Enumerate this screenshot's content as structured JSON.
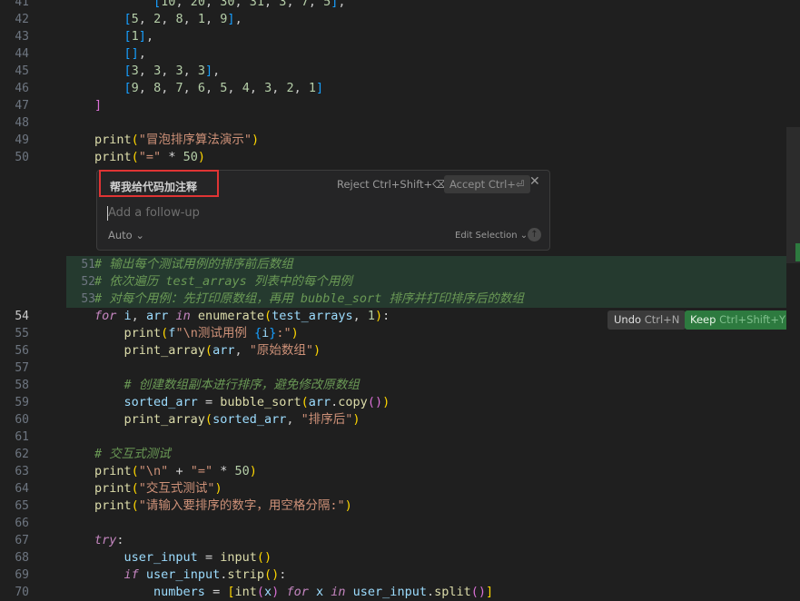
{
  "editor": {
    "lines": [
      {
        "n": "41",
        "html": "        <span class='p3'>[</span><span class='num'>10</span>, <span class='num'>20</span>, <span class='num'>30</span>, <span class='num'>31</span>, <span class='num'>3</span>, <span class='num'>7</span>, <span class='num'>5</span><span class='p3'>]</span>,"
      },
      {
        "n": "42",
        "html": "    <span class='p3'>[</span><span class='num'>5</span>, <span class='num'>2</span>, <span class='num'>8</span>, <span class='num'>1</span>, <span class='num'>9</span><span class='p3'>]</span>,"
      },
      {
        "n": "43",
        "html": "    <span class='p3'>[</span><span class='num'>1</span><span class='p3'>]</span>,"
      },
      {
        "n": "44",
        "html": "    <span class='p3'>[]</span>,"
      },
      {
        "n": "45",
        "html": "    <span class='p3'>[</span><span class='num'>3</span>, <span class='num'>3</span>, <span class='num'>3</span>, <span class='num'>3</span><span class='p3'>]</span>,"
      },
      {
        "n": "46",
        "html": "    <span class='p3'>[</span><span class='num'>9</span>, <span class='num'>8</span>, <span class='num'>7</span>, <span class='num'>6</span>, <span class='num'>5</span>, <span class='num'>4</span>, <span class='num'>3</span>, <span class='num'>2</span>, <span class='num'>1</span><span class='p3'>]</span>"
      },
      {
        "n": "47",
        "html": "<span class='p2'>]</span>"
      },
      {
        "n": "48",
        "html": ""
      },
      {
        "n": "49",
        "html": "<span class='fn'>print</span><span class='p1'>(</span><span class='str'>\"冒泡排序算法演示\"</span><span class='p1'>)</span>"
      },
      {
        "n": "50",
        "html": "<span class='fn'>print</span><span class='p1'>(</span><span class='str'>\"=\"</span> <span class='op'>*</span> <span class='num'>50</span><span class='p1'>)</span>"
      },
      {
        "n": "51",
        "html": "<span class='cmt'># 输出每个测试用例的排序前后数组</span>",
        "hl": true
      },
      {
        "n": "52",
        "html": "<span class='cmt'># 依次遍历 test_arrays 列表中的每个用例</span>",
        "hl": true
      },
      {
        "n": "53",
        "html": "<span class='cmt'># 对每个用例：先打印原数组，再用 bubble_sort 排序并打印排序后的数组</span>",
        "hl": true
      },
      {
        "n": "54",
        "html": "<span class='kw'>for</span> <span class='var'>i</span>, <span class='var'>arr</span> <span class='kw'>in</span> <span class='fn'>enumerate</span><span class='p1'>(</span><span class='var'>test_arrays</span>, <span class='num'>1</span><span class='p1'>)</span>:",
        "active": true
      },
      {
        "n": "55",
        "html": "    <span class='fn'>print</span><span class='p1'>(</span><span class='var'>f</span><span class='str'>\"\\n测试用例 </span><span class='p3'>{</span><span class='var'>i</span><span class='p3'>}</span><span class='str'>:\"</span><span class='p1'>)</span>"
      },
      {
        "n": "56",
        "html": "    <span class='fn'>print_array</span><span class='p1'>(</span><span class='var'>arr</span>, <span class='str'>\"原始数组\"</span><span class='p1'>)</span>"
      },
      {
        "n": "57",
        "html": ""
      },
      {
        "n": "58",
        "html": "    <span class='cmt'># 创建数组副本进行排序，避免修改原数组</span>"
      },
      {
        "n": "59",
        "html": "    <span class='var'>sorted_arr</span> <span class='op'>=</span> <span class='fn'>bubble_sort</span><span class='p1'>(</span><span class='var'>arr</span>.<span class='fn'>copy</span><span class='p2'>()</span><span class='p1'>)</span>"
      },
      {
        "n": "60",
        "html": "    <span class='fn'>print_array</span><span class='p1'>(</span><span class='var'>sorted_arr</span>, <span class='str'>\"排序后\"</span><span class='p1'>)</span>"
      },
      {
        "n": "61",
        "html": ""
      },
      {
        "n": "62",
        "html": "<span class='cmt'># 交互式测试</span>"
      },
      {
        "n": "63",
        "html": "<span class='fn'>print</span><span class='p1'>(</span><span class='str'>\"\\n\"</span> <span class='op'>+</span> <span class='str'>\"=\"</span> <span class='op'>*</span> <span class='num'>50</span><span class='p1'>)</span>"
      },
      {
        "n": "64",
        "html": "<span class='fn'>print</span><span class='p1'>(</span><span class='str'>\"交互式测试\"</span><span class='p1'>)</span>"
      },
      {
        "n": "65",
        "html": "<span class='fn'>print</span><span class='p1'>(</span><span class='str'>\"请输入要排序的数字，用空格分隔:\"</span><span class='p1'>)</span>"
      },
      {
        "n": "66",
        "html": ""
      },
      {
        "n": "67",
        "html": "<span class='kw'>try</span>:"
      },
      {
        "n": "68",
        "html": "    <span class='var'>user_input</span> <span class='op'>=</span> <span class='fn'>input</span><span class='p1'>()</span>"
      },
      {
        "n": "69",
        "html": "    <span class='kw'>if</span> <span class='var'>user_input</span>.<span class='fn'>strip</span><span class='p1'>()</span>:"
      },
      {
        "n": "70",
        "html": "        <span class='var'>numbers</span> <span class='op'>=</span> <span class='p1'>[</span><span class='fn'>int</span><span class='p2'>(</span><span class='var'>x</span><span class='p2'>)</span> <span class='kw'>for</span> <span class='var'>x</span> <span class='kw'>in</span> <span class='var'>user_input</span>.<span class='fn'>split</span><span class='p2'>()</span><span class='p1'>]</span>"
      }
    ]
  },
  "chat": {
    "prompt": "帮我给代码加注释",
    "reject_label": "Reject Ctrl+Shift+⌫",
    "accept_label": "Accept Ctrl+⏎",
    "close_glyph": "✕",
    "followup_placeholder": "Add a follow-up",
    "mode_label": "Auto ⌄",
    "edit_selection_label": "Edit Selection ⌄",
    "send_glyph": "↑"
  },
  "diff_actions": {
    "undo_label": "Undo",
    "undo_shortcut": "Ctrl+N",
    "keep_label": "Keep",
    "keep_shortcut": "Ctrl+Shift+Y"
  }
}
